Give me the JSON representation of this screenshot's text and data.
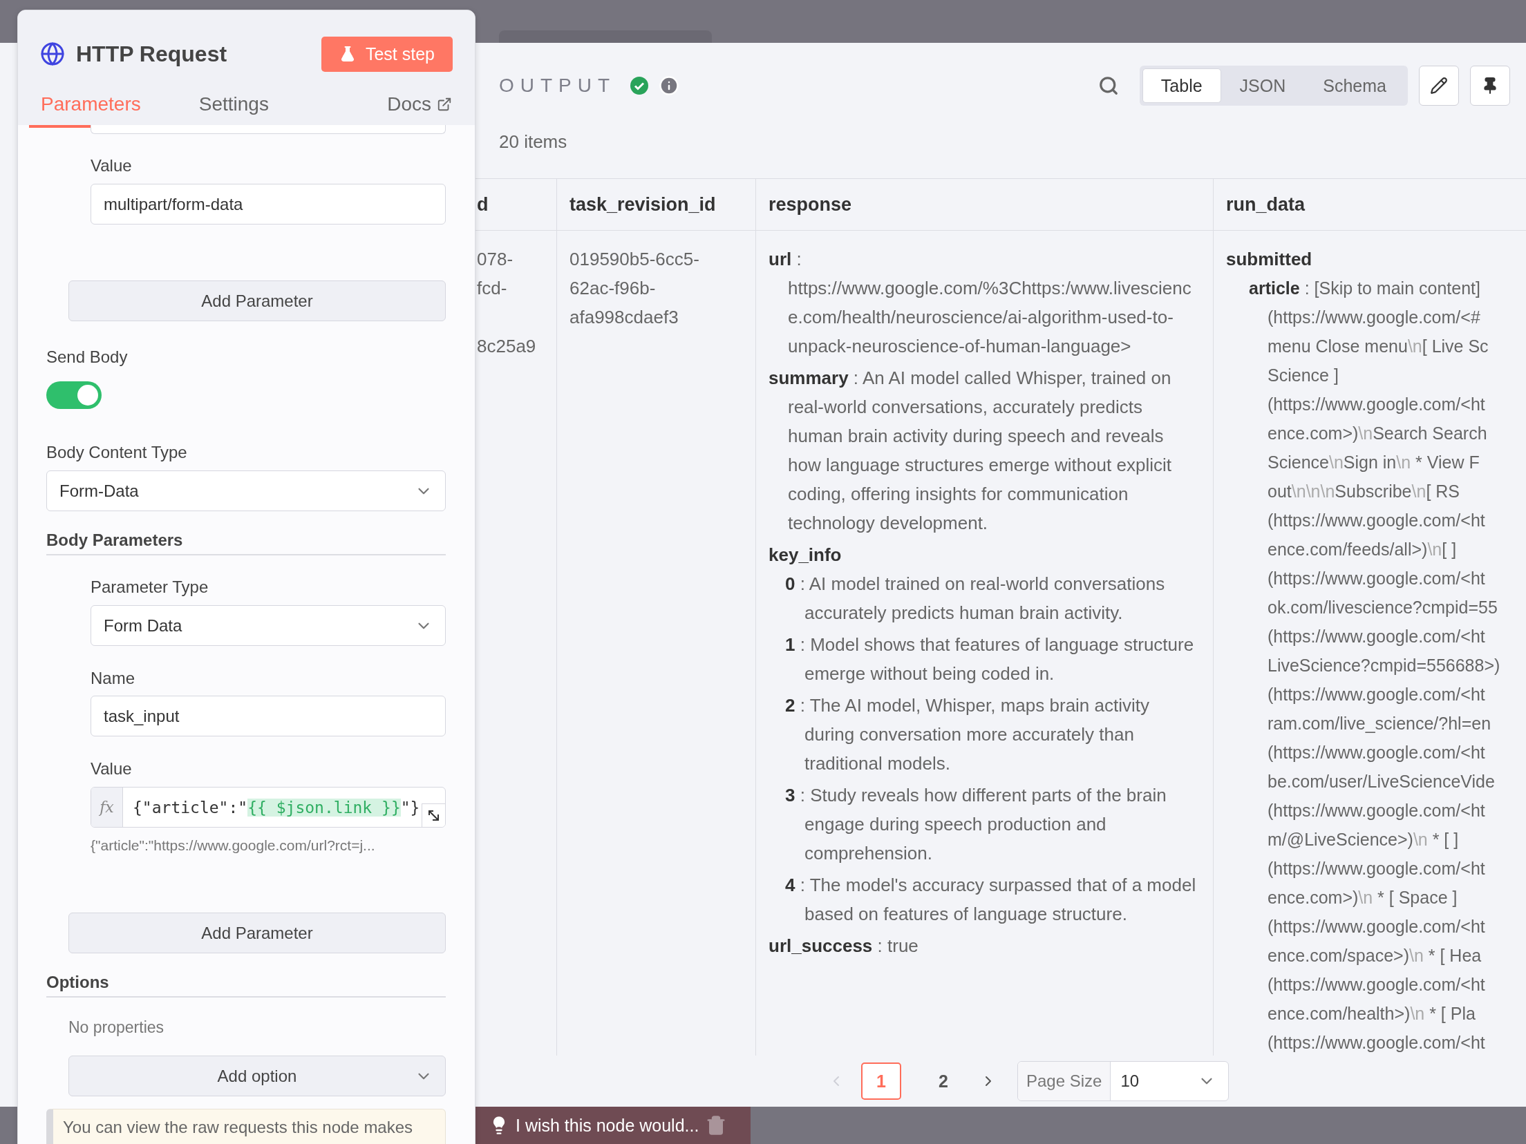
{
  "node_panel": {
    "title": "HTTP Request",
    "test_button": "Test step",
    "tabs": [
      {
        "label": "Parameters",
        "selected": true
      },
      {
        "label": "Settings",
        "selected": false
      }
    ],
    "docs_link": "Docs",
    "header_value": {
      "label": "Value",
      "value": "multipart/form-data"
    },
    "add_header_button": "Add Parameter",
    "send_body": {
      "label": "Send Body",
      "on": true
    },
    "body_content_type": {
      "label": "Body Content Type",
      "value": "Form-Data"
    },
    "body_parameters": {
      "title": "Body Parameters",
      "parameter_type": {
        "label": "Parameter Type",
        "value": "Form Data"
      },
      "name": {
        "label": "Name",
        "value": "task_input"
      },
      "value": {
        "label": "Value",
        "fx": "fx",
        "parts": [
          {
            "kind": "plain",
            "text": "{\"article\":\""
          },
          {
            "kind": "expression",
            "text": "{{ $json.link }}"
          },
          {
            "kind": "plain",
            "text": "\"}"
          }
        ],
        "preview": "{\"article\":\"https://www.google.com/url?rct=j..."
      },
      "add_button": "Add Parameter"
    },
    "options": {
      "title": "Options",
      "empty_text": "No properties",
      "add_button": "Add option"
    },
    "notice": "You can view the raw requests this node makes"
  },
  "output": {
    "title": "OUTPUT",
    "success": true,
    "count": "20 items",
    "views": [
      {
        "label": "Table",
        "selected": true
      },
      {
        "label": "JSON",
        "selected": false
      },
      {
        "label": "Schema",
        "selected": false
      }
    ],
    "table": {
      "key_separator": ":",
      "columns": [
        "d",
        "task_revision_id",
        "response",
        "run_data"
      ],
      "id_cell": [
        "078-",
        "fcd-",
        "8c25a9"
      ],
      "task_revision_id": "019590b5-6cc5-62ac-f96b-afa998cdaef3",
      "response": [
        {
          "key": "url",
          "value": "https://www.google.com/%3Chttps:/www.livescience.com/health/neuroscience/ai-algorithm-used-to-unpack-neuroscience-of-human-language>"
        },
        {
          "key": "summary",
          "value": "An AI model called Whisper, trained on real-world conversations, accurately predicts human brain activity during speech and reveals how language structures emerge without explicit coding, offering insights for communication technology development."
        },
        {
          "key": "key_info",
          "items": [
            {
              "key": "0",
              "value": "AI model trained on real-world conversations accurately predicts human brain activity."
            },
            {
              "key": "1",
              "value": "Model shows that features of language structure emerge without being coded in."
            },
            {
              "key": "2",
              "value": "The AI model, Whisper, maps brain activity during conversation more accurately than traditional models."
            },
            {
              "key": "3",
              "value": "Study reveals how different parts of the brain engage during speech production and comprehension."
            },
            {
              "key": "4",
              "value": "The model's accuracy surpassed that of a model based on features of language structure."
            }
          ]
        },
        {
          "key": "url_success",
          "value": "true"
        }
      ],
      "run_data": {
        "key": "submitted",
        "child_key": "article",
        "first_line": "[Skip to main content]",
        "lines": [
          "(https://www.google.com/<#",
          "menu Close menu\\n[ Live Sc",
          "Science ]",
          "(https://www.google.com/<ht",
          "ence.com>)\\nSearch Search",
          "Science\\nSign in\\n  * View F",
          "out\\n\\n\\nSubscribe\\n[ RS",
          "(https://www.google.com/<ht",
          "ence.com/feeds/all>)\\n[ ]",
          "(https://www.google.com/<ht",
          "ok.com/livescience?cmpid=55",
          "(https://www.google.com/<ht",
          "LiveScience?cmpid=556688>)",
          "(https://www.google.com/<ht",
          "ram.com/live_science/?hl=en",
          "(https://www.google.com/<ht",
          "be.com/user/LiveScienceVide",
          "(https://www.google.com/<ht",
          "m/@LiveScience>)\\n  * [ ]",
          "(https://www.google.com/<ht",
          "ence.com>)\\n  * [ Space ]",
          "(https://www.google.com/<ht",
          "ence.com/space>)\\n  * [ Hea",
          "(https://www.google.com/<ht",
          "ence.com/health>)\\n  * [ Pla",
          "(https://www.google.com/<ht"
        ]
      }
    },
    "pagination": {
      "prev_disabled": true,
      "pages": [
        {
          "label": "1",
          "selected": true
        },
        {
          "label": "2",
          "selected": false
        }
      ],
      "page_size_label": "Page Size",
      "page_size": "10"
    }
  },
  "toast": {
    "text": "I wish this node would..."
  }
}
